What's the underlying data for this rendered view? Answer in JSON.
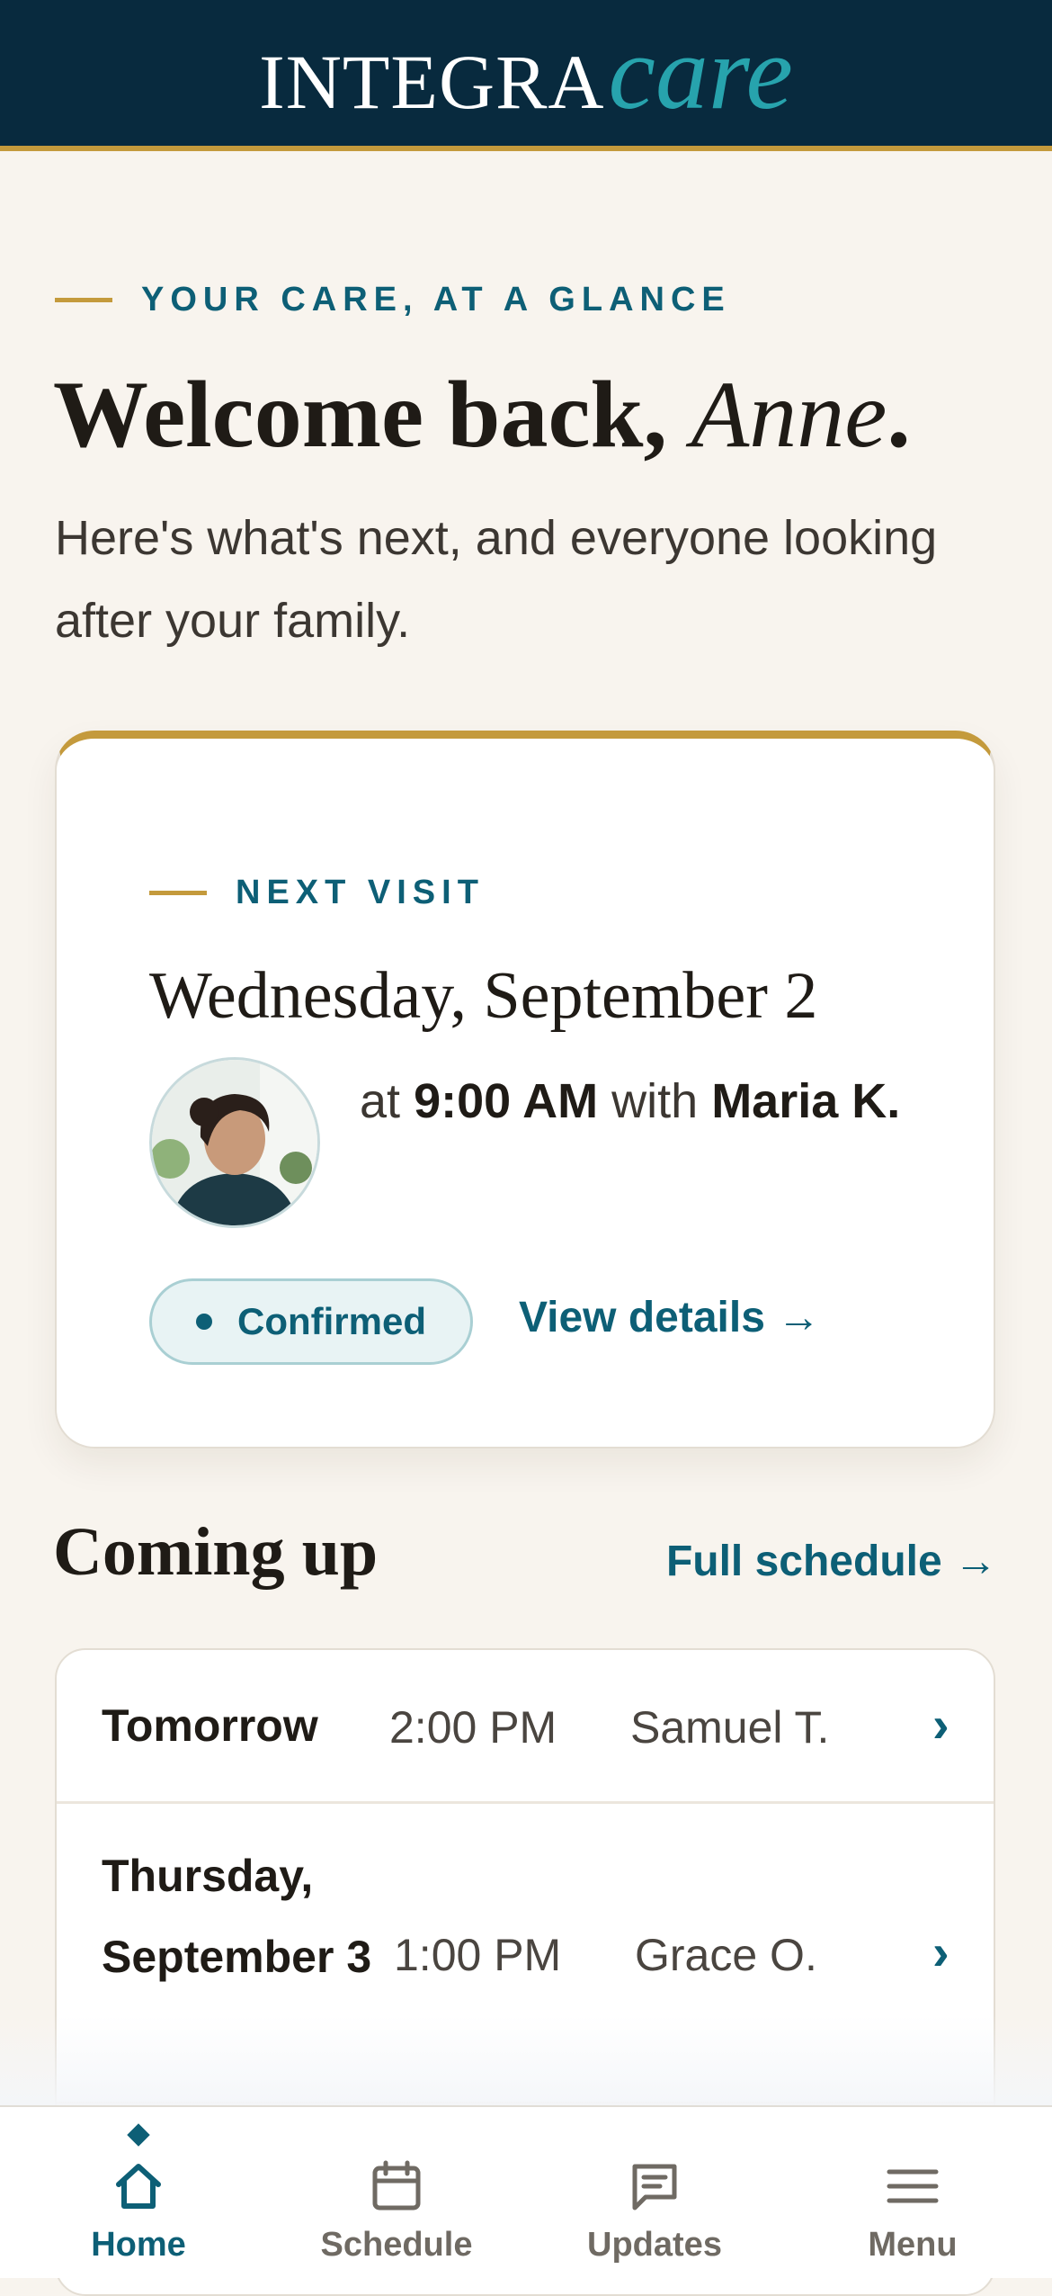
{
  "header": {
    "brand": "INTEGRA",
    "brand_accent": "care"
  },
  "hero": {
    "eyebrow": "YOUR CARE, AT A GLANCE",
    "greeting": "Welcome back,",
    "name": "Anne",
    "punctuation": ".",
    "intro": "Here's what's next, and everyone looking after your family."
  },
  "next_visit": {
    "eyebrow": "NEXT VISIT",
    "date": "Wednesday, September 2",
    "at_word": "at",
    "time": "9:00 AM",
    "with_word": "with",
    "caregiver": "Maria K.",
    "status": "Confirmed",
    "details_link": "View details →"
  },
  "coming_up": {
    "title": "Coming up",
    "schedule_link": "Full schedule →",
    "rows": [
      {
        "day": "Tomorrow",
        "time": "2:00 PM",
        "caregiver": "Samuel T."
      },
      {
        "day": "Thursday, September 3",
        "time": "1:00 PM",
        "caregiver": "Grace O."
      }
    ],
    "chevron": "›"
  },
  "nav": {
    "tabs": [
      {
        "label": "Home",
        "icon": "home-icon",
        "active": true
      },
      {
        "label": "Schedule",
        "icon": "calendar-icon",
        "active": false
      },
      {
        "label": "Updates",
        "icon": "message-icon",
        "active": false
      },
      {
        "label": "Menu",
        "icon": "hamburger-icon",
        "active": false
      }
    ]
  },
  "colors": {
    "navy": "#082a3e",
    "teal": "#0d5f76",
    "gold": "#c49a3c",
    "cream": "#f8f4ee"
  }
}
